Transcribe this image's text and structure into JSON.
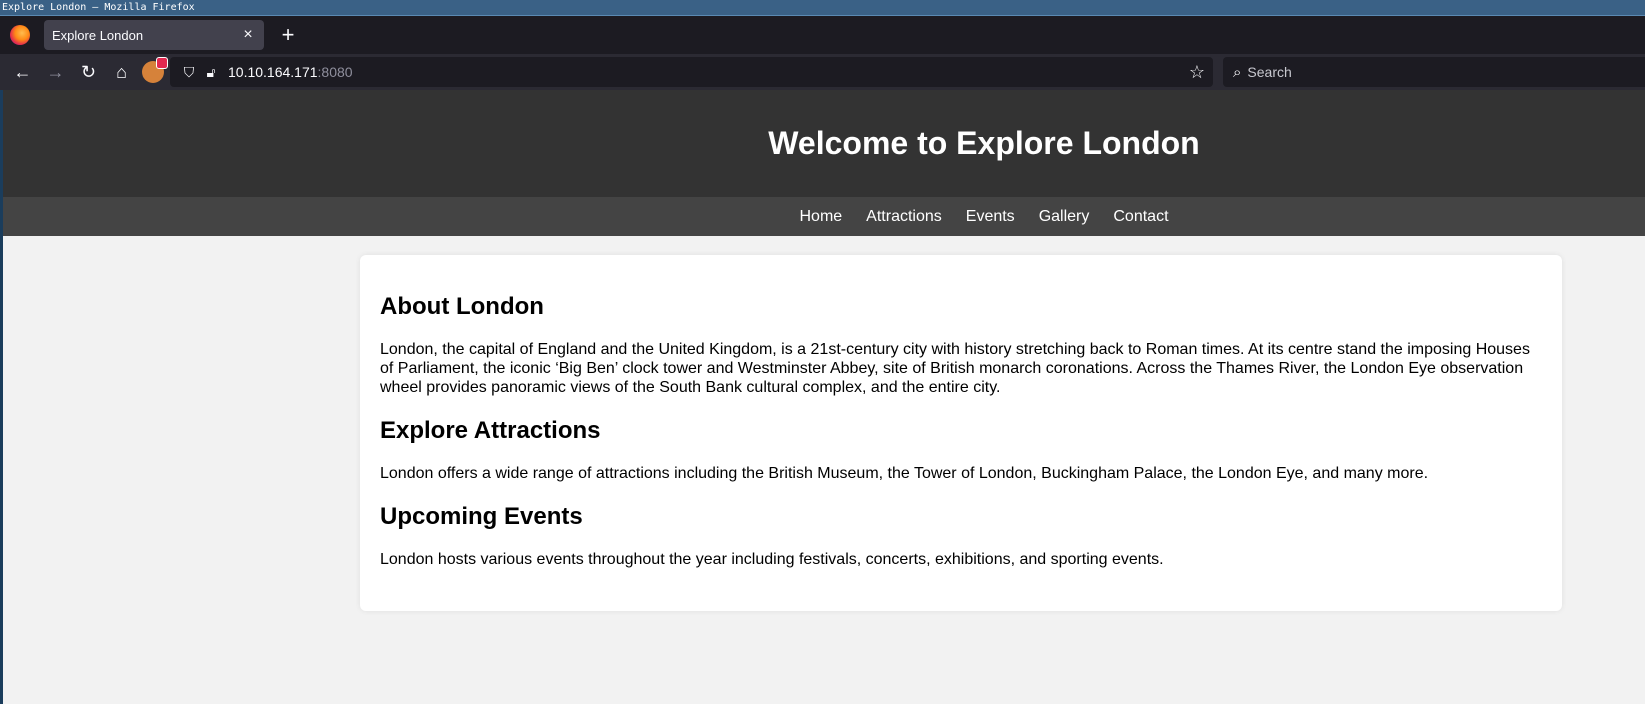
{
  "window": {
    "title": "Explore London — Mozilla Firefox"
  },
  "browser": {
    "tab": {
      "label": "Explore London"
    },
    "url": {
      "host": "10.10.164.171",
      "port": ":8080"
    },
    "search_placeholder": "Search"
  },
  "site": {
    "title": "Welcome to Explore London",
    "nav": [
      "Home",
      "Attractions",
      "Events",
      "Gallery",
      "Contact"
    ],
    "sections": [
      {
        "heading": "About London",
        "text": "London, the capital of England and the United Kingdom, is a 21st-century city with history stretching back to Roman times. At its centre stand the imposing Houses of Parliament, the iconic ‘Big Ben’ clock tower and Westminster Abbey, site of British monarch coronations. Across the Thames River, the London Eye observation wheel provides panoramic views of the South Bank cultural complex, and the entire city."
      },
      {
        "heading": "Explore Attractions",
        "text": "London offers a wide range of attractions including the British Museum, the Tower of London, Buckingham Palace, the London Eye, and many more."
      },
      {
        "heading": "Upcoming Events",
        "text": "London hosts various events throughout the year including festivals, concerts, exhibitions, and sporting events."
      }
    ]
  }
}
